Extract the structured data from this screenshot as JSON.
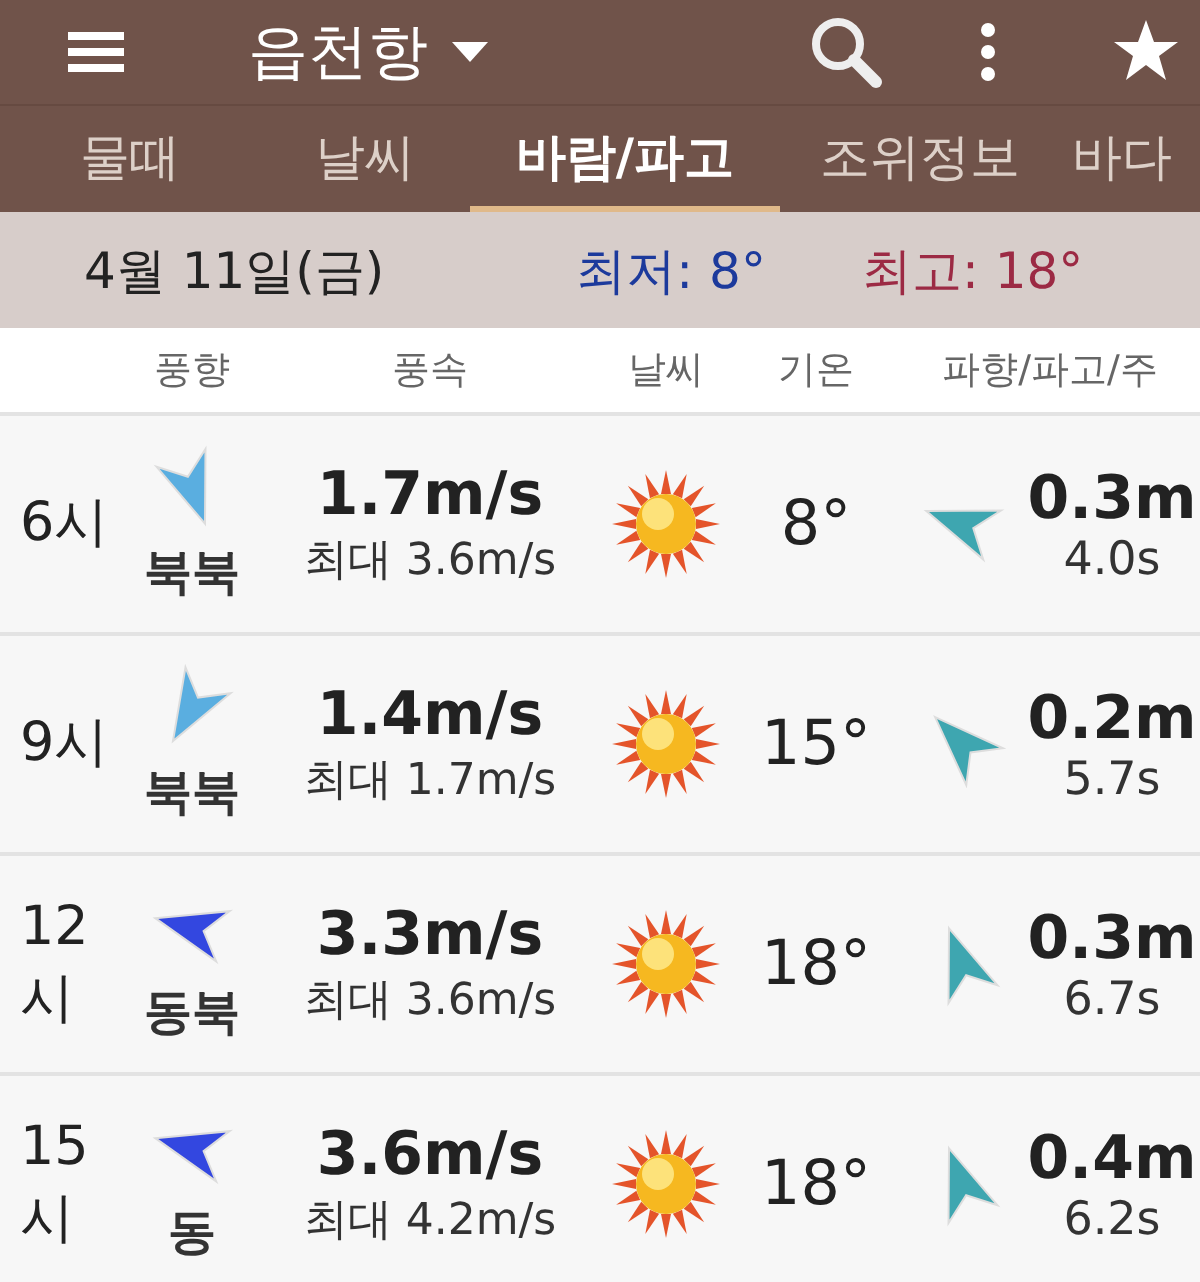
{
  "app_bar": {
    "location": "읍천항"
  },
  "tabs": [
    {
      "label": "물때",
      "selected": false
    },
    {
      "label": "날씨",
      "selected": false
    },
    {
      "label": "바람/파고",
      "selected": true
    },
    {
      "label": "조위정보",
      "selected": false
    },
    {
      "label": "바다",
      "selected": false
    }
  ],
  "date_band": {
    "date": "4월 11일(금)",
    "low": "최저: 8°",
    "high": "최고: 18°"
  },
  "columns": [
    "풍향",
    "풍속",
    "날씨",
    "기온",
    "파향/파고/주"
  ],
  "rows": [
    {
      "time": "6시",
      "wind_dir": "북북",
      "color": "#5aaee0",
      "wind_speed": "1.7m/s",
      "gust": "최대 3.6m/s",
      "temp": "8°",
      "wave_height": "0.3m",
      "wave_period": "4.0s"
    },
    {
      "time": "9시",
      "wind_dir": "북북",
      "color": "#5aaee0",
      "wind_speed": "1.4m/s",
      "gust": "최대 1.7m/s",
      "temp": "15°",
      "wave_height": "0.2m",
      "wave_period": "5.7s"
    },
    {
      "time": "12시",
      "wind_dir": "동북",
      "color": "#3347e0",
      "wind_speed": "3.3m/s",
      "gust": "최대 3.6m/s",
      "temp": "18°",
      "wave_height": "0.3m",
      "wave_period": "6.7s"
    },
    {
      "time": "15시",
      "wind_dir": "동",
      "color": "#3347e0",
      "wind_speed": "3.6m/s",
      "gust": "최대 4.2m/s",
      "temp": "18°",
      "wave_height": "0.4m",
      "wave_period": "6.2s"
    }
  ]
}
